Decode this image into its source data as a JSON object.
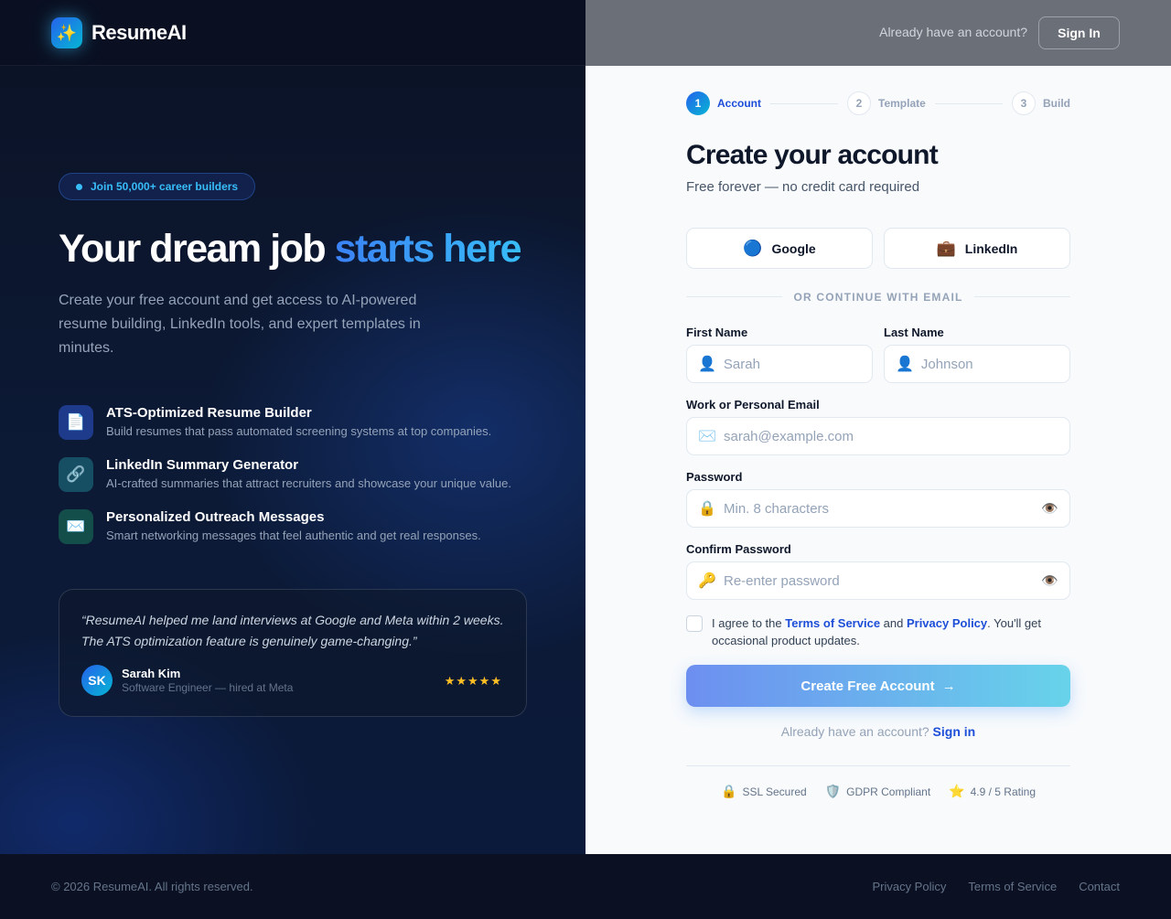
{
  "brand": {
    "name": "ResumeAI",
    "logo_icon": "✨"
  },
  "header": {
    "already_text": "Already have an account?",
    "signin_label": "Sign In"
  },
  "left": {
    "badge": "Join 50,000+ career builders",
    "title_main": "Your dream job ",
    "title_accent": "starts here",
    "subtitle": "Create your free account and get access to AI-powered resume building, LinkedIn tools, and expert templates in minutes.",
    "features": [
      {
        "icon": "📄",
        "title": "ATS-Optimized Resume Builder",
        "desc": "Build resumes that pass automated screening systems at top companies."
      },
      {
        "icon": "🔗",
        "title": "LinkedIn Summary Generator",
        "desc": "AI-crafted summaries that attract recruiters and showcase your unique value."
      },
      {
        "icon": "✉️",
        "title": "Personalized Outreach Messages",
        "desc": "Smart networking messages that feel authentic and get real responses."
      }
    ],
    "testimonial": {
      "quote": "“ResumeAI helped me land interviews at Google and Meta within 2 weeks. The ATS optimization feature is genuinely game-changing.”",
      "initials": "SK",
      "name": "Sarah Kim",
      "role": "Software Engineer — hired at Meta",
      "stars": "★★★★★",
      "rating": 5
    }
  },
  "stepper": {
    "steps": [
      {
        "num": "1",
        "label": "Account",
        "state": "active"
      },
      {
        "num": "2",
        "label": "Template",
        "state": "idle"
      },
      {
        "num": "3",
        "label": "Build",
        "state": "idle"
      }
    ]
  },
  "form": {
    "title": "Create your account",
    "subtitle": "Free forever — no credit card required",
    "social": {
      "google": {
        "icon": "🔵",
        "label": "Google"
      },
      "linkedin": {
        "icon": "💼",
        "label": "LinkedIn"
      }
    },
    "divider": "OR CONTINUE WITH EMAIL",
    "first_name": {
      "label": "First Name",
      "placeholder": "Sarah",
      "value": "",
      "icon": "👤"
    },
    "last_name": {
      "label": "Last Name",
      "placeholder": "Johnson",
      "value": "",
      "icon": "👤"
    },
    "email": {
      "label": "Work or Personal Email",
      "placeholder": "sarah@example.com",
      "value": "",
      "icon": "✉️"
    },
    "password": {
      "label": "Password",
      "placeholder": "Min. 8 characters",
      "value": "",
      "icon": "🔒",
      "eye": "👁️"
    },
    "confirm": {
      "label": "Confirm Password",
      "placeholder": "Re-enter password",
      "value": "",
      "icon": "🔑",
      "eye": "👁️"
    },
    "agree": {
      "prefix": "I agree to the ",
      "terms": "Terms of Service",
      "and": " and ",
      "privacy": "Privacy Policy",
      "suffix": ". You'll get occasional product updates.",
      "checked": false
    },
    "cta_label": "Create Free Account",
    "cta_arrow": "→",
    "already_text": "Already have an account? ",
    "signin_link": "Sign in"
  },
  "trust": [
    {
      "icon": "🔒",
      "label": "SSL Secured"
    },
    {
      "icon": "🛡️",
      "label": "GDPR Compliant"
    },
    {
      "icon": "⭐",
      "label": "4.9 / 5 Rating"
    }
  ],
  "footer": {
    "copyright": "© 2026 ResumeAI. All rights reserved.",
    "links": [
      "Privacy Policy",
      "Terms of Service",
      "Contact"
    ]
  },
  "colors": {
    "accent": "#1d4ed8",
    "accent_cyan": "#38bdf8",
    "star": "#fbbf24"
  }
}
